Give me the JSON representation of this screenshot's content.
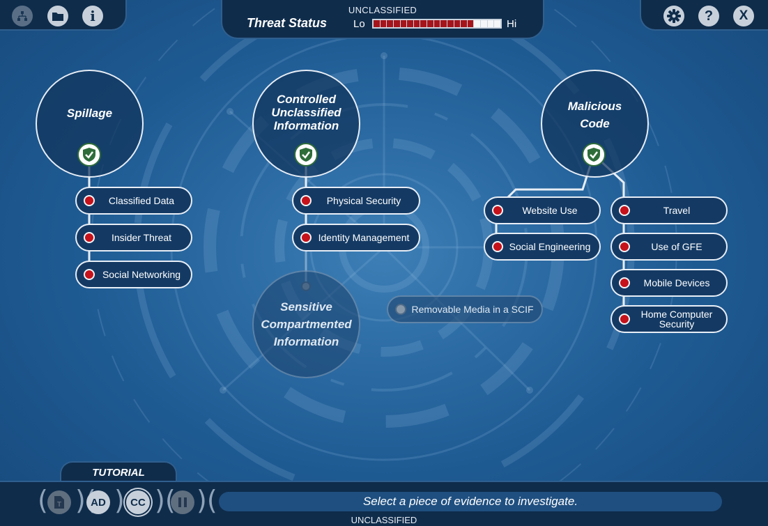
{
  "classification": {
    "top": "UNCLASSIFIED",
    "bottom": "UNCLASSIFIED"
  },
  "threat_status": {
    "title": "Threat Status",
    "low_label": "Lo",
    "high_label": "Hi",
    "level_filled": 15,
    "level_total": 19,
    "fill_color": "#a5141b"
  },
  "toolbar_left": {
    "icons": [
      "sitemap-icon",
      "folder-icon",
      "info-icon"
    ],
    "info_glyph": "i"
  },
  "toolbar_right": {
    "icons": [
      "gear-icon",
      "help-icon",
      "close-icon"
    ],
    "help_glyph": "?",
    "close_glyph": "X"
  },
  "categories": {
    "spillage": {
      "title": "Spillage",
      "completed": true,
      "items": [
        "Classified Data",
        "Insider Threat",
        "Social Networking"
      ]
    },
    "cui": {
      "title_lines": [
        "Controlled",
        "Unclassified",
        "Information"
      ],
      "completed": true,
      "items": [
        "Physical Security",
        "Identity Management"
      ]
    },
    "sci": {
      "title_lines": [
        "Sensitive",
        "Compartmented",
        "Information"
      ],
      "locked": true,
      "items": [
        "Removable Media in a SCIF"
      ]
    },
    "malicious_code": {
      "title_lines": [
        "Malicious",
        "Code"
      ],
      "completed": true,
      "left_items": [
        "Website Use",
        "Social Engineering"
      ],
      "right_items": [
        "Travel",
        "Use of GFE",
        "Mobile Devices",
        "Home Computer Security"
      ]
    }
  },
  "home_computer_lines": [
    "Home Computer",
    "Security"
  ],
  "bottom": {
    "tutorial_label": "TUTORIAL",
    "prompt": "Select a piece of evidence to investigate.",
    "controls": {
      "transcript": "T",
      "audio_description": "AD",
      "closed_captions": "CC"
    }
  },
  "colors": {
    "accent_red": "#c5121b",
    "check_green": "#2e6d3a",
    "panel_dark": "#0f2c4b"
  }
}
